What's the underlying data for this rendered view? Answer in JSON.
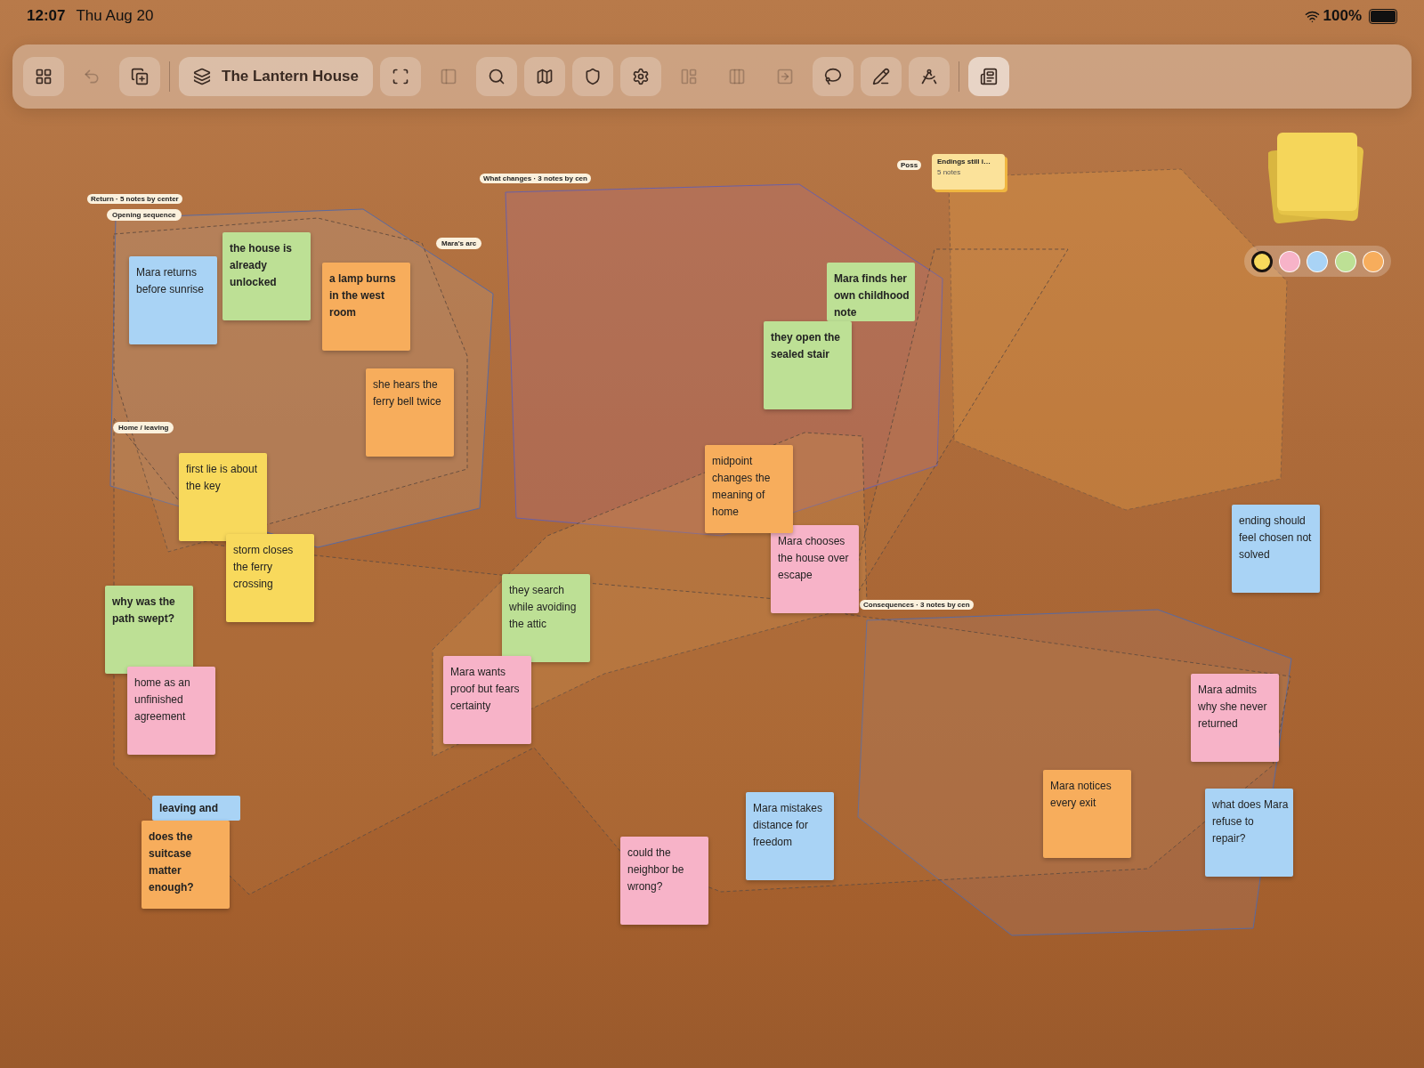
{
  "status_bar": {
    "time": "12:07",
    "date": "Thu Aug 20",
    "battery": "100%"
  },
  "toolbar": [
    {
      "kind": "icon",
      "disabled": false,
      "selected": false
    },
    {
      "kind": "icon",
      "disabled": true,
      "selected": false
    },
    {
      "kind": "icon",
      "disabled": false,
      "selected": false
    },
    {
      "kind": "divider"
    },
    {
      "kind": "title",
      "label": "The Lantern House"
    },
    {
      "kind": "icon",
      "disabled": false,
      "selected": false
    },
    {
      "kind": "icon",
      "disabled": true,
      "selected": false
    },
    {
      "kind": "icon",
      "disabled": false,
      "selected": false
    },
    {
      "kind": "icon",
      "disabled": false,
      "selected": false
    },
    {
      "kind": "icon",
      "disabled": false,
      "selected": false
    },
    {
      "kind": "icon",
      "disabled": false,
      "selected": false
    },
    {
      "kind": "icon",
      "disabled": true,
      "selected": false
    },
    {
      "kind": "icon",
      "disabled": true,
      "selected": false
    },
    {
      "kind": "icon",
      "disabled": true,
      "selected": false
    },
    {
      "kind": "icon",
      "disabled": false,
      "selected": false
    },
    {
      "kind": "icon",
      "disabled": false,
      "selected": false
    },
    {
      "kind": "icon",
      "disabled": false,
      "selected": false
    },
    {
      "kind": "divider"
    },
    {
      "kind": "icon",
      "disabled": false,
      "selected": true
    }
  ],
  "group_labels": [
    {
      "text": "Return · 5 notes by center",
      "kind": "small"
    },
    {
      "text": "Opening sequence",
      "kind": "tag"
    },
    {
      "text": "Mara's arc",
      "kind": "tag"
    },
    {
      "text": "Home / leaving",
      "kind": "tag"
    },
    {
      "text": "What changes · 3 notes by cen",
      "kind": "small"
    },
    {
      "text": "Consequences · 3 notes by cen",
      "kind": "small"
    },
    {
      "text": "Poss",
      "kind": "small"
    }
  ],
  "stack_card": {
    "title": "Endings still i…",
    "count": "5 notes"
  },
  "notes": [
    {
      "text": "Mara returns before sunrise",
      "color": "#a9d3f5",
      "bold": false
    },
    {
      "text": "the house is already unlocked",
      "color": "#bde095",
      "bold": true
    },
    {
      "text": "a lamp burns in the west room",
      "color": "#f7ad5c",
      "bold": true
    },
    {
      "text": "she hears the ferry bell twice",
      "color": "#f7ad5c",
      "bold": false
    },
    {
      "text": "first lie is about the key",
      "color": "#f8d95c",
      "bold": false
    },
    {
      "text": "storm closes the ferry crossing",
      "color": "#f8d95c",
      "bold": false
    },
    {
      "text": "why was the path swept?",
      "color": "#bde095",
      "bold": true
    },
    {
      "text": "home as an unfinished agreement",
      "color": "#f7b3c8",
      "bold": false
    },
    {
      "text": "leaving and",
      "color": "#a9d3f5",
      "bold": true
    },
    {
      "text": "does the suitcase matter enough?",
      "color": "#f7ad5c",
      "bold": true
    },
    {
      "text": "they search while avoiding the attic",
      "color": "#bde095",
      "bold": false
    },
    {
      "text": "Mara wants proof but fears certainty",
      "color": "#f7b3c8",
      "bold": false
    },
    {
      "text": "Mara chooses the house over escape",
      "color": "#f7b3c8",
      "bold": false
    },
    {
      "text": "midpoint changes the meaning of home",
      "color": "#f7ad5c",
      "bold": false
    },
    {
      "text": "Mara finds her own childhood note",
      "color": "#bde095",
      "bold": true
    },
    {
      "text": "they open the sealed stair",
      "color": "#bde095",
      "bold": true
    },
    {
      "text": "ending should feel chosen not solved",
      "color": "#a9d3f5",
      "bold": false
    },
    {
      "text": "Mara admits why she never returned",
      "color": "#f7b3c8",
      "bold": false
    },
    {
      "text": "could the neighbor be wrong?",
      "color": "#f7b3c8",
      "bold": false
    },
    {
      "text": "Mara mistakes distance for freedom",
      "color": "#a9d3f5",
      "bold": false
    },
    {
      "text": "Mara notices every exit",
      "color": "#f7ad5c",
      "bold": false
    },
    {
      "text": "what does Mara refuse to repair?",
      "color": "#a9d3f5",
      "bold": false
    }
  ],
  "palette": [
    {
      "color": "#f8d95c",
      "selected": true
    },
    {
      "color": "#f7b3c8",
      "selected": false
    },
    {
      "color": "#a9d3f5",
      "selected": false
    },
    {
      "color": "#bde095",
      "selected": false
    },
    {
      "color": "#f7ad5c",
      "selected": false
    }
  ]
}
